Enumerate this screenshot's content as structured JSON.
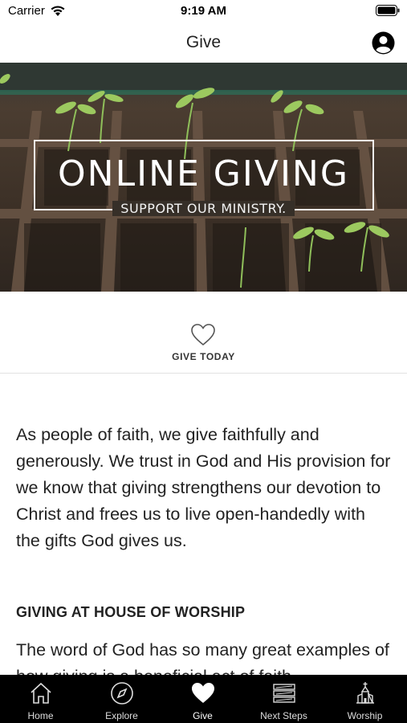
{
  "status_bar": {
    "carrier": "Carrier",
    "time": "9:19 AM"
  },
  "nav": {
    "title": "Give"
  },
  "hero": {
    "title": "ONLINE GIVING",
    "subtitle": "SUPPORT OUR MINISTRY."
  },
  "give_today": {
    "label": "GIVE TODAY"
  },
  "content": {
    "paragraph": "As people of faith, we give faithfully and generously. We trust in God and His provision for we know that giving strengthens our devotion to Christ and frees us to live open-handedly with the gifts God gives us.",
    "section_heading": "GIVING AT HOUSE OF WORSHIP",
    "paragraph_2": "The word of God has so many great examples of how giving is a beneficial act of faith."
  },
  "tabs": [
    {
      "label": "Home",
      "icon": "home-icon"
    },
    {
      "label": "Explore",
      "icon": "compass-icon"
    },
    {
      "label": "Give",
      "icon": "heart-icon",
      "active": true
    },
    {
      "label": "Next Steps",
      "icon": "steps-icon"
    },
    {
      "label": "Worship",
      "icon": "church-icon"
    }
  ]
}
